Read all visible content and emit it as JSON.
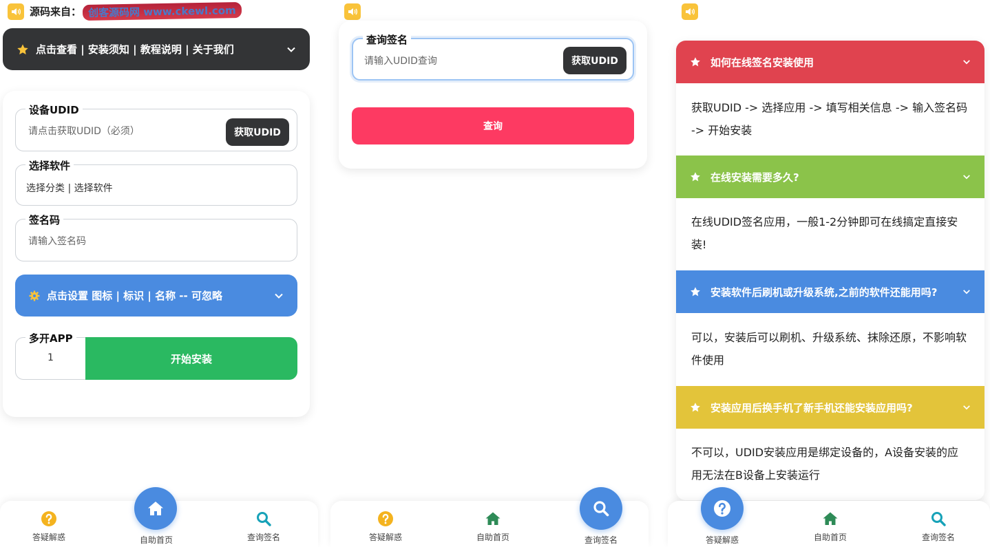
{
  "colors": {
    "dark": "#333436",
    "blue": "#4a8be0",
    "green": "#2ab961",
    "pink": "#fd3a62",
    "red_header": "#e0434f",
    "green_header": "#8bc34a",
    "blue_header": "#4a8be0",
    "yellow_header": "#e3c43a",
    "help_icon": "#f4b31f",
    "home_icon": "#2e8b57",
    "search_icon": "#17a2b8"
  },
  "header": {
    "source_label": "源码来自：",
    "source_value": "创客源码网 www.ckewl.com"
  },
  "install": {
    "menu_title": "点击查看 | 安装须知 | 教程说明 | 关于我们",
    "udid_legend": "设备UDID",
    "udid_placeholder": "请点击获取UDID（必须）",
    "get_udid": "获取UDID",
    "software_legend": "选择软件",
    "software_value": "选择分类 | 选择软件",
    "code_legend": "签名码",
    "code_placeholder": "请输入签名码",
    "settings_label": "点击设置 图标 | 标识 | 名称 -- 可忽略",
    "multi_legend": "多开APP",
    "multi_value": "1",
    "start_button": "开始安装"
  },
  "query": {
    "legend": "查询签名",
    "placeholder": "请输入UDID查询",
    "get_udid": "获取UDID",
    "query_button": "查询"
  },
  "faq": {
    "items": [
      {
        "q": "如何在线签名安装使用",
        "a": "获取UDID -> 选择应用 -> 填写相关信息 -> 输入签名码 -> 开始安装"
      },
      {
        "q": "在线安装需要多久?",
        "a": "在线UDID签名应用，一般1-2分钟即可在线搞定直接安装!"
      },
      {
        "q": "安装软件后刷机或升级系统,之前的软件还能用吗?",
        "a": "可以，安装后可以刷机、升级系统、抹除还原，不影响软件使用"
      },
      {
        "q": "安装应用后换手机了新手机还能安装应用吗?",
        "a": "不可以，UDID安装应用是绑定设备的，A设备安装的应用无法在B设备上安装运行"
      }
    ]
  },
  "nav": {
    "help": "答疑解惑",
    "home": "自助首页",
    "query": "查询签名",
    "icons": {
      "help": "question-circle-icon",
      "home": "home-icon",
      "query": "search-icon"
    }
  }
}
